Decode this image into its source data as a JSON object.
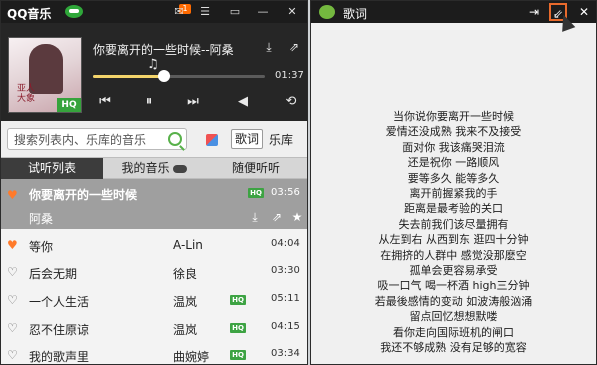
{
  "player": {
    "app_name": "QQ音乐",
    "notification_badge": "1",
    "now_playing": {
      "title": "你要离开的一些时候--阿桑",
      "elapsed": "01:37",
      "progress_fraction": 0.41
    },
    "album_caption": "亚人\n大象",
    "album_badge": "HQ",
    "search": {
      "placeholder": "搜索列表内、乐库的音乐"
    },
    "lyric_button": "歌词",
    "library_button": "乐库",
    "tabs": [
      {
        "label": "试听列表",
        "active": true
      },
      {
        "label": "我的音乐",
        "active": false
      },
      {
        "label": "随便听听",
        "active": false
      }
    ],
    "current_song": {
      "title": "你要离开的一些时候",
      "artist": "阿桑",
      "duration": "03:56",
      "badge": "HQ"
    },
    "songs": [
      {
        "title": "等你",
        "artist": "A-Lin",
        "duration": "04:04",
        "hq": false,
        "liked": true
      },
      {
        "title": "后会无期",
        "artist": "徐良",
        "duration": "03:30",
        "hq": false,
        "liked": false
      },
      {
        "title": "一个人生活",
        "artist": "温岚",
        "duration": "05:11",
        "hq": true,
        "liked": false
      },
      {
        "title": "忍不住原谅",
        "artist": "温岚",
        "duration": "04:15",
        "hq": true,
        "liked": false
      },
      {
        "title": "我的歌声里",
        "artist": "曲婉婷",
        "duration": "03:34",
        "hq": true,
        "liked": false
      }
    ],
    "hq_label": "HQ",
    "colors": {
      "accent_orange": "#ff7a2a",
      "hq_green": "#3da343",
      "progress": "#f3d46b"
    }
  },
  "lyrics_window": {
    "title": "歌词",
    "lines": [
      "当你说你要离开一些时候",
      "爱情还没成熟 我来不及接受",
      "面对你 我该痛哭泪流",
      "还是祝你 一路顺风",
      "要等多久 能等多久",
      "离开前握紧我的手",
      "距离是最考验的关口",
      "失去前我们该尽量拥有",
      "从左到右 从西到东 逛四十分钟",
      "在拥挤的人群中 感觉没那麽空",
      "孤单会更容易承受",
      "吸一口气 喝一杯酒 high三分钟",
      "若最後感情的变动 如波涛般汹涌",
      "留点回忆想想默喽",
      "看你走向国际班机的闸口",
      "我还不够成熟 没有足够的宽容"
    ]
  }
}
